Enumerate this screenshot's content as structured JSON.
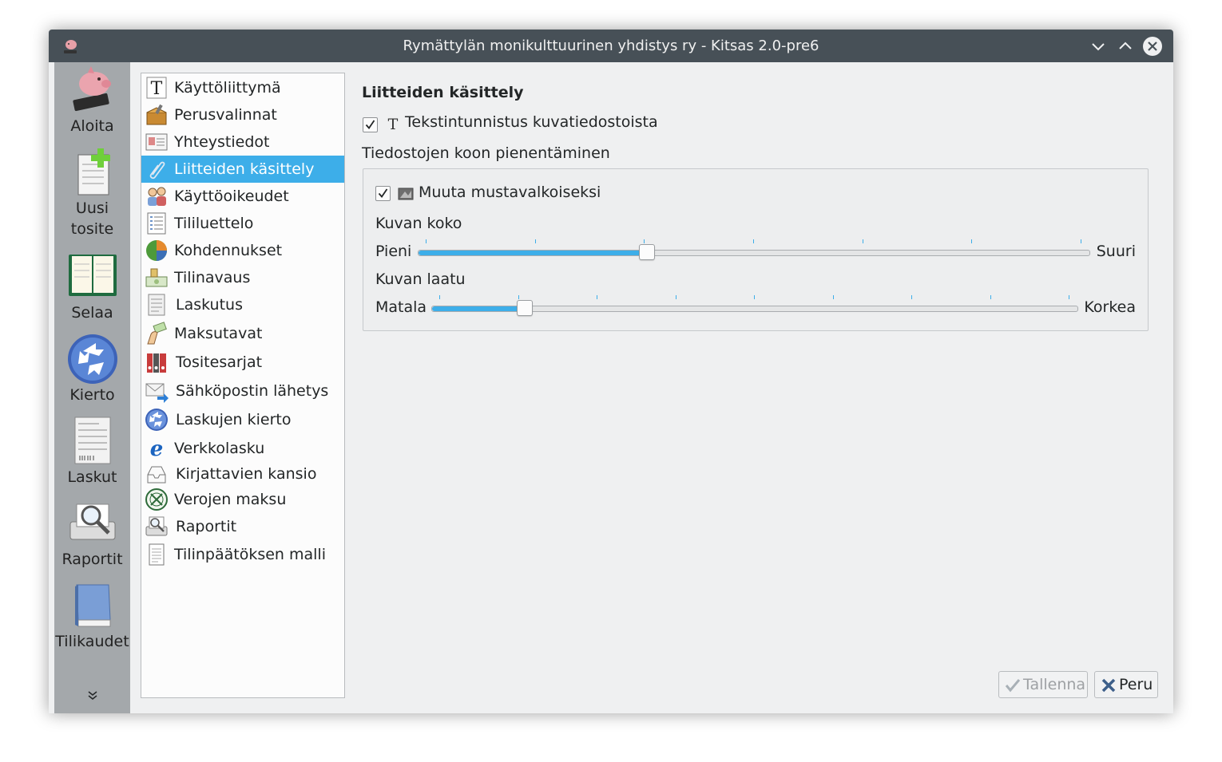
{
  "window": {
    "title": "Rymättylän monikulttuurinen yhdistys ry - Kitsas 2.0-pre6"
  },
  "sidebar": {
    "items": [
      {
        "label": "Aloita",
        "icon": "piggy-bank-icon"
      },
      {
        "label": "Uusi\ntosite",
        "icon": "new-document-icon"
      },
      {
        "label": "Selaa",
        "icon": "ledger-book-icon"
      },
      {
        "label": "Kierto",
        "icon": "circulation-icon"
      },
      {
        "label": "Laskut",
        "icon": "invoice-icon"
      },
      {
        "label": "Raportit",
        "icon": "reports-icon"
      },
      {
        "label": "Tilikaudet",
        "icon": "book-icon"
      }
    ],
    "more_icon": "double-chevron-down-icon"
  },
  "settings_list": {
    "items": [
      {
        "label": "Käyttöliittymä",
        "icon": "text-t-icon"
      },
      {
        "label": "Perusvalinnat",
        "icon": "package-tools-icon"
      },
      {
        "label": "Yhteystiedot",
        "icon": "contact-card-icon"
      },
      {
        "label": "Liitteiden käsittely",
        "icon": "paperclip-icon",
        "selected": true
      },
      {
        "label": "Käyttöoikeudet",
        "icon": "users-icon"
      },
      {
        "label": "Tililuettelo",
        "icon": "account-list-icon"
      },
      {
        "label": "Kohdennukset",
        "icon": "pie-chart-icon"
      },
      {
        "label": "Tilinavaus",
        "icon": "money-icon"
      },
      {
        "label": "Laskutus",
        "icon": "invoice-icon"
      },
      {
        "label": "Maksutavat",
        "icon": "hand-money-icon"
      },
      {
        "label": "Tositesarjat",
        "icon": "binders-icon"
      },
      {
        "label": "Sähköpostin lähetys",
        "icon": "email-send-icon"
      },
      {
        "label": "Laskujen kierto",
        "icon": "circulation-icon"
      },
      {
        "label": "Verkkolasku",
        "icon": "e-invoice-icon"
      },
      {
        "label": "Kirjattavien kansio",
        "icon": "inbox-tray-icon"
      },
      {
        "label": "Verojen maksu",
        "icon": "tax-seal-icon"
      },
      {
        "label": "Raportit",
        "icon": "reports-icon"
      },
      {
        "label": "Tilinpäätöksen malli",
        "icon": "document-icon"
      }
    ]
  },
  "attachments": {
    "title": "Liitteiden käsittely",
    "ocr_checkbox": {
      "label": "Tekstintunnistus kuvatiedostoista",
      "checked": true
    },
    "resize_title": "Tiedostojen koon pienentäminen",
    "grayscale_checkbox": {
      "label": "Muuta mustavalkoiseksi",
      "checked": true
    },
    "size": {
      "label": "Kuvan koko",
      "min_label": "Pieni",
      "max_label": "Suuri",
      "value_fraction": 0.337
    },
    "quality": {
      "label": "Kuvan laatu",
      "min_label": "Matala",
      "max_label": "Korkea",
      "value_fraction": 0.135
    }
  },
  "buttons": {
    "save": {
      "label": "Tallenna",
      "enabled": false
    },
    "cancel": {
      "label": "Peru"
    }
  },
  "colors": {
    "accent": "#3daee9",
    "titlebar": "#475057",
    "sidebar": "#a4a8ab"
  }
}
